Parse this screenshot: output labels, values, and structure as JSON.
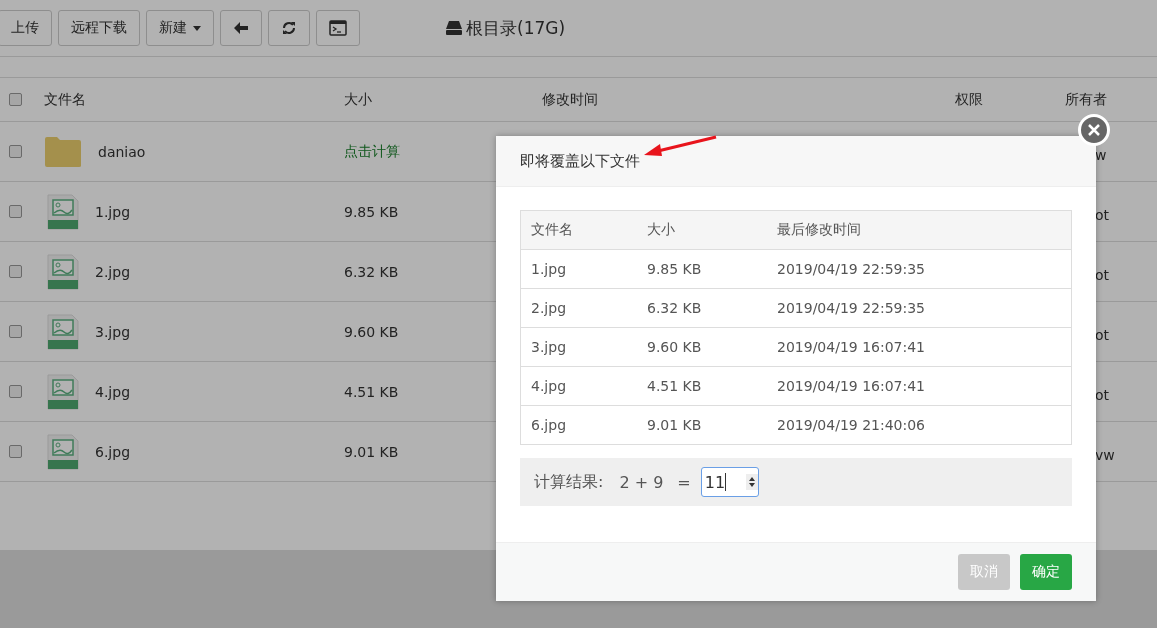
{
  "toolbar": {
    "buttons": [
      {
        "kind": "text",
        "label": "上传"
      },
      {
        "kind": "text",
        "label": "远程下载"
      },
      {
        "kind": "dropdown",
        "label": "新建"
      },
      {
        "kind": "back"
      },
      {
        "kind": "refresh"
      },
      {
        "kind": "terminal"
      }
    ],
    "path": "根目录(17G)"
  },
  "file_table": {
    "columns": [
      "文件名",
      "大小",
      "修改时间",
      "权限",
      "所有者"
    ],
    "header_checked": false,
    "rows": [
      {
        "kind": "folder",
        "checked": false,
        "name": "daniao",
        "size": "点击计算",
        "owner": "w"
      },
      {
        "kind": "jpg",
        "checked": false,
        "name": "1.jpg",
        "size": "9.85 KB",
        "owner": "ot"
      },
      {
        "kind": "jpg",
        "checked": false,
        "name": "2.jpg",
        "size": "6.32 KB",
        "owner": "ot"
      },
      {
        "kind": "jpg",
        "checked": false,
        "name": "3.jpg",
        "size": "9.60 KB",
        "owner": "ot"
      },
      {
        "kind": "jpg",
        "checked": false,
        "name": "4.jpg",
        "size": "4.51 KB",
        "owner": "ot"
      },
      {
        "kind": "jpg",
        "checked": false,
        "name": "6.jpg",
        "size": "9.01 KB",
        "owner": "vw"
      }
    ]
  },
  "dialog": {
    "title": "即将覆盖以下文件",
    "columns": [
      "文件名",
      "大小",
      "最后修改时间"
    ],
    "rows": [
      [
        "1.jpg",
        "9.85 KB",
        "2019/04/19 22:59:35"
      ],
      [
        "2.jpg",
        "6.32 KB",
        "2019/04/19 22:59:35"
      ],
      [
        "3.jpg",
        "9.60 KB",
        "2019/04/19 16:07:41"
      ],
      [
        "4.jpg",
        "4.51 KB",
        "2019/04/19 16:07:41"
      ],
      [
        "6.jpg",
        "9.01 KB",
        "2019/04/19 21:40:06"
      ]
    ],
    "captcha": {
      "label": "计算结果:",
      "question": "2 + 9",
      "equals": "=",
      "value": "11"
    },
    "buttons": [
      {
        "kind": "cancel",
        "label": "取消"
      },
      {
        "kind": "confirm",
        "label": "确定"
      }
    ]
  }
}
